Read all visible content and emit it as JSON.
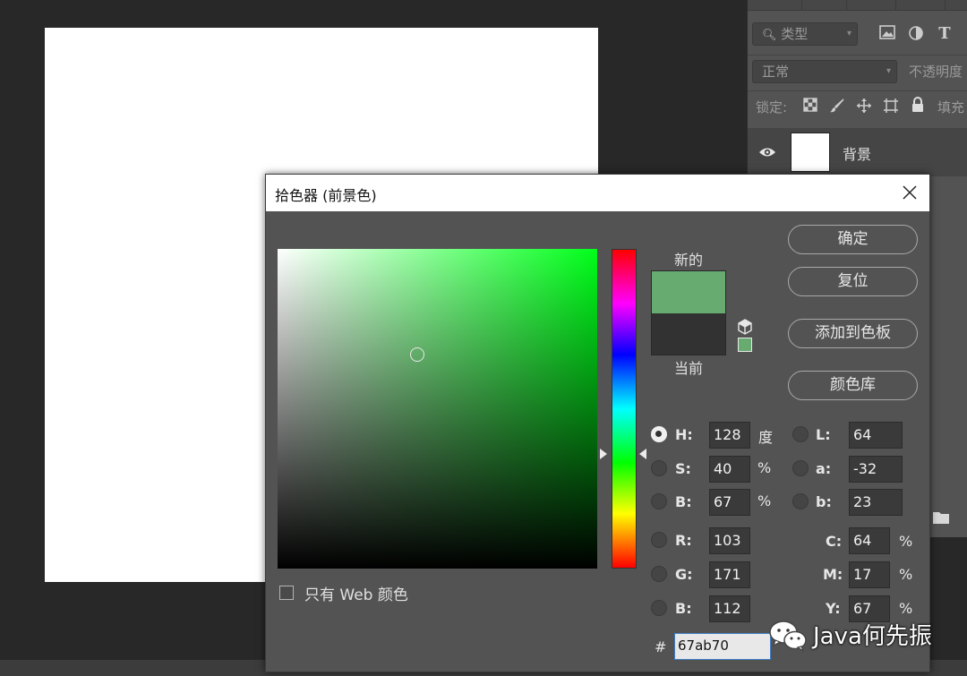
{
  "layers_panel": {
    "filter_kind_label": "类型",
    "blend_mode_label": "正常",
    "opacity_label": "不透明度",
    "lock_label": "锁定:",
    "fill_label": "填充",
    "layer_name": "背景"
  },
  "dialog": {
    "title": "拾色器 (前景色)",
    "new_label": "新的",
    "current_label": "当前",
    "new_color": "#67ab70",
    "current_color": "#333233",
    "buttons": {
      "ok": "确定",
      "reset": "复位",
      "add_to_swatches": "添加到色板",
      "color_libraries": "颜色库"
    },
    "fields": {
      "h": {
        "label": "H:",
        "value": "128",
        "unit": "度",
        "selected": true
      },
      "s": {
        "label": "S:",
        "value": "40",
        "unit": "%"
      },
      "b": {
        "label": "B:",
        "value": "67",
        "unit": "%"
      },
      "r": {
        "label": "R:",
        "value": "103"
      },
      "g": {
        "label": "G:",
        "value": "171"
      },
      "b2": {
        "label": "B:",
        "value": "112"
      },
      "l": {
        "label": "L:",
        "value": "64"
      },
      "a": {
        "label": "a:",
        "value": "-32"
      },
      "lab_b": {
        "label": "b:",
        "value": "23"
      },
      "c": {
        "label": "C:",
        "value": "64",
        "unit": "%"
      },
      "m": {
        "label": "M:",
        "value": "17",
        "unit": "%"
      },
      "y": {
        "label": "Y:",
        "value": "67",
        "unit": "%"
      }
    },
    "hex_label": "#",
    "hex_value": "67ab70",
    "web_only_label": "只有 Web 颜色",
    "hue_strip_colors": [
      "#ff0000",
      "#ff00ff",
      "#0000ff",
      "#00ffff",
      "#00ff00",
      "#ffff00"
    ]
  },
  "watermark": {
    "text": "Java何先振"
  }
}
